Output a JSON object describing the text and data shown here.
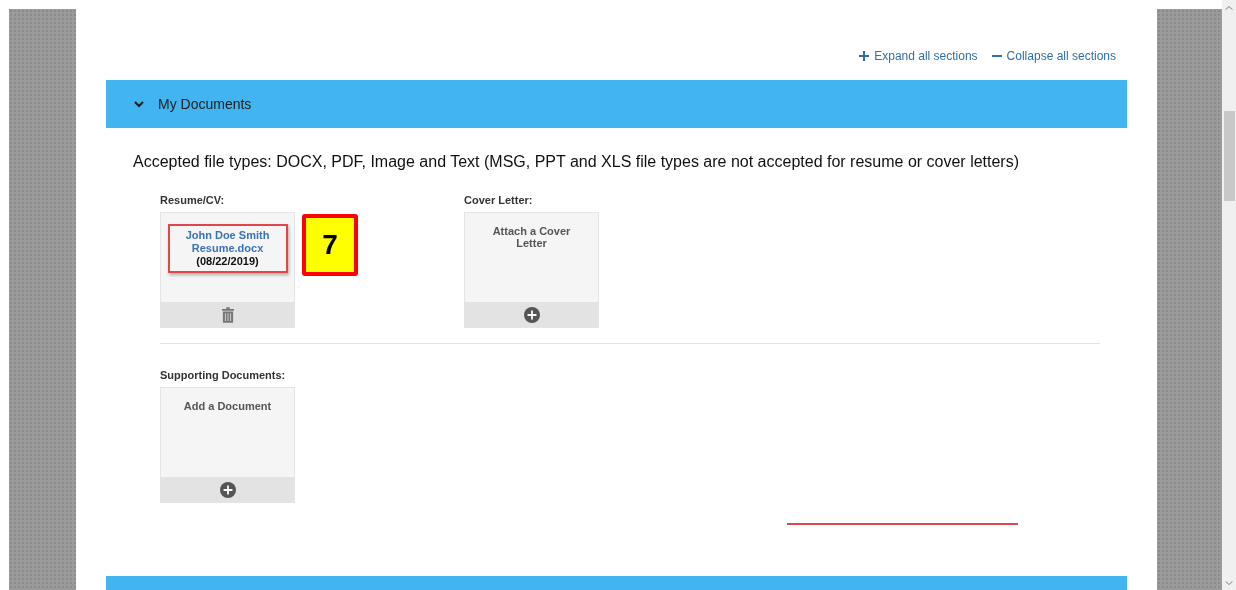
{
  "toolbar_links": [
    {
      "label": "Expand all sections"
    },
    {
      "label": "Collapse all sections"
    }
  ],
  "section": {
    "title": "My Documents",
    "expanded": true
  },
  "accepted_note": "Accepted file types: DOCX, PDF, Image and Text (MSG, PPT and XLS file types are not accepted for resume or cover letters)",
  "upload_slots": [
    {
      "label": "Resume/CV:",
      "kind": "file",
      "file_name": "John Doe Smith Resume.docx",
      "date": "(08/22/2019)",
      "highlighted": true,
      "callout": "7"
    },
    {
      "label": "Cover Letter:",
      "kind": "empty",
      "prompt": "Attach a Cover Letter"
    }
  ],
  "supporting": {
    "label": "Supporting Documents:",
    "kind": "empty",
    "prompt": "Add a Document"
  }
}
